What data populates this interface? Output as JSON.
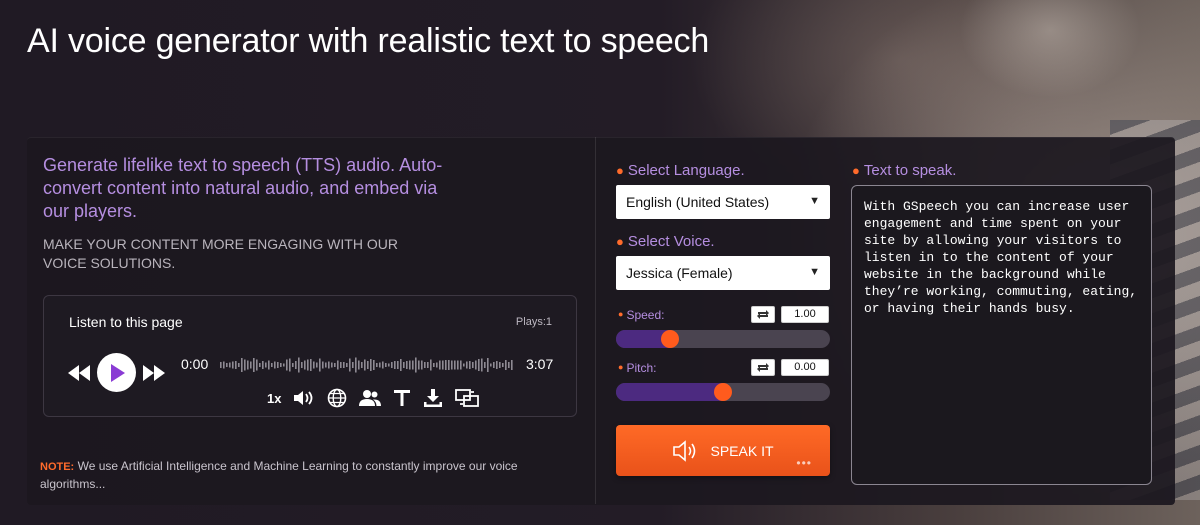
{
  "page": {
    "heading": "AI voice generator with realistic text to speech"
  },
  "intro": {
    "lead": "Generate lifelike text to speech (TTS) audio. Auto-convert content into natural audio, and embed via our players.",
    "sub": "MAKE YOUR CONTENT MORE ENGAGING WITH OUR VOICE SOLUTIONS."
  },
  "player": {
    "title": "Listen to this page",
    "plays": "Plays:1",
    "current_time": "0:00",
    "total_time": "3:07",
    "rate": "1x",
    "icons": [
      "rewind-icon",
      "play-icon",
      "forward-icon",
      "volume-icon",
      "globe-icon",
      "users-icon",
      "text-icon",
      "download-icon",
      "embed-icon"
    ],
    "progress": 0
  },
  "note": {
    "label": "NOTE:",
    "text": "We use Artificial Intelligence and Machine Learning to constantly improve our voice algorithms..."
  },
  "language": {
    "label": "Select Language.",
    "value": "English (United States)"
  },
  "voice": {
    "label": "Select Voice.",
    "value": "Jessica (Female)"
  },
  "speed": {
    "label": "Speed:",
    "value": "1.00",
    "level": 0.25
  },
  "pitch": {
    "label": "Pitch:",
    "value": "0.00",
    "level": 0.5
  },
  "speak_button": {
    "label": "SPEAK IT"
  },
  "text_to_speak": {
    "label": "Text to speak.",
    "value": "With GSpeech you can increase user engagement and time spent on your site by allowing your visitors to listen in to the content of your website in the background while they’re working, commuting, eating, or having their hands busy."
  },
  "colors": {
    "accent": "#ff5b1d",
    "label_purple": "#b58ee0",
    "slider_fill": "#4c2a80"
  }
}
